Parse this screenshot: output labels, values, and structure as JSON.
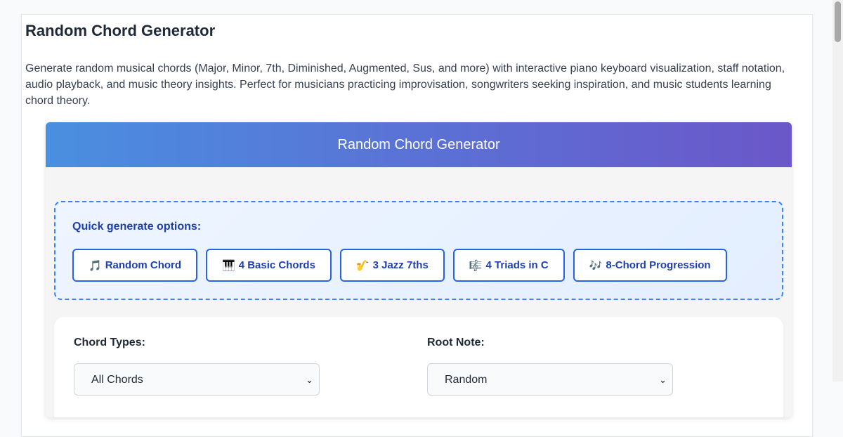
{
  "page": {
    "title": "Random Chord Generator",
    "description": "Generate random musical chords (Major, Minor, 7th, Diminished, Augmented, Sus, and more) with interactive piano keyboard visualization, staff notation, audio playback, and music theory insights. Perfect for musicians practicing improvisation, songwriters seeking inspiration, and music students learning chord theory."
  },
  "tool": {
    "header_title": "Random Chord Generator",
    "header_gradient": [
      "#4a8fe0",
      "#6b57c9"
    ]
  },
  "quick": {
    "label": "Quick generate options:",
    "buttons": [
      {
        "emoji": "🎵",
        "label": "Random Chord",
        "icon": "music-note-icon"
      },
      {
        "emoji": "🎹",
        "label": "4 Basic Chords",
        "icon": "piano-icon"
      },
      {
        "emoji": "🎷",
        "label": "3 Jazz 7ths",
        "icon": "saxophone-icon"
      },
      {
        "emoji": "🎼",
        "label": "4 Triads in C",
        "icon": "musical-score-icon"
      },
      {
        "emoji": "🎶",
        "label": "8-Chord Progression",
        "icon": "music-notes-icon"
      }
    ],
    "accent": "#2563eb"
  },
  "settings": {
    "chord_types_label": "Chord Types:",
    "chord_types_value": "All Chords",
    "root_note_label": "Root Note:",
    "root_note_value": "Random"
  }
}
